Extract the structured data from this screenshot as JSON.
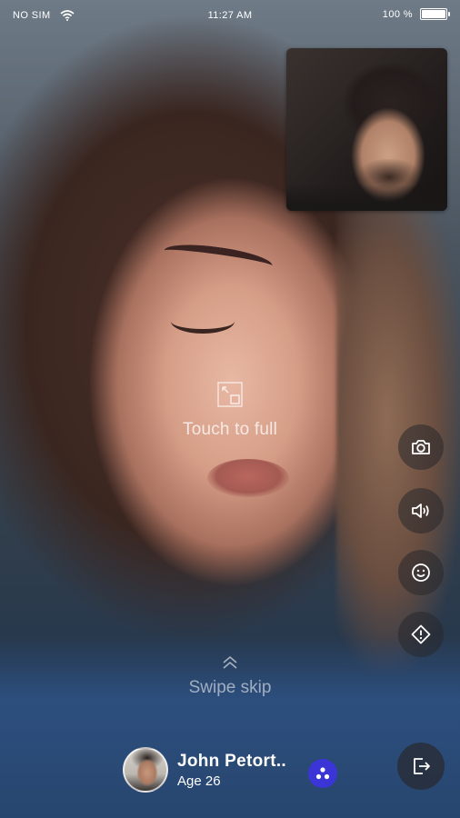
{
  "status_bar": {
    "carrier": "NO SIM",
    "time": "11:27 AM",
    "battery": "100 %",
    "battery_level": 1.0
  },
  "center_hint": {
    "icon": "expand-icon",
    "text": "Touch to full"
  },
  "actions": [
    {
      "name": "camera",
      "icon": "camera-icon"
    },
    {
      "name": "speaker",
      "icon": "speaker-icon"
    },
    {
      "name": "emoji",
      "icon": "smiley-icon"
    },
    {
      "name": "report",
      "icon": "warning-icon"
    }
  ],
  "swipe": {
    "icon": "chevron-up-icon",
    "text": "Swipe skip"
  },
  "user": {
    "name": "John Petort..",
    "age": "Age 26"
  },
  "colors": {
    "follow_accent": "#3b35d8",
    "button_bg": "rgba(40,40,44,0.55)"
  }
}
